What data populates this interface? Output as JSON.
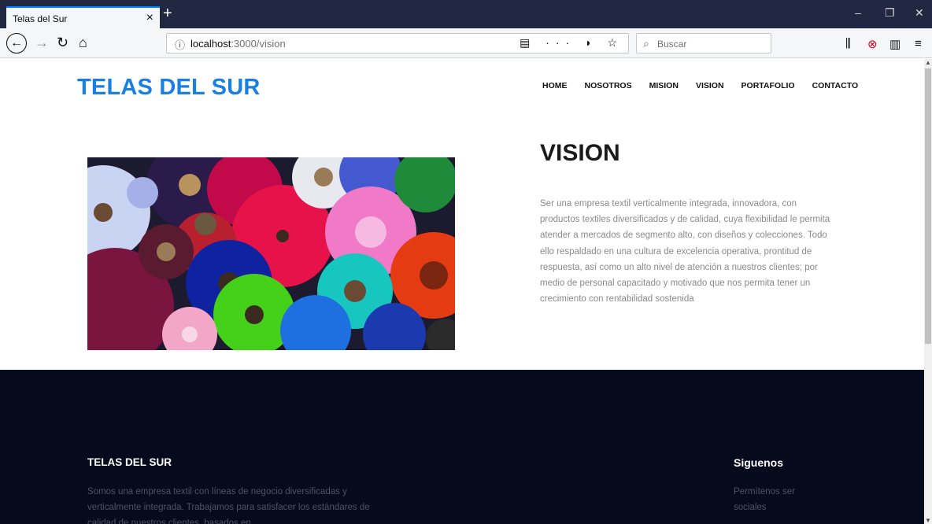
{
  "browser": {
    "tab_title": "Telas del Sur",
    "tab_close": "×",
    "new_tab": "+",
    "url_host": "localhost",
    "url_path": ":3000/vision",
    "search_placeholder": "Buscar",
    "minimize": "–",
    "restore": "❐",
    "close": "✕"
  },
  "site": {
    "logo": "TELAS DEL SUR",
    "menu": [
      "HOME",
      "NOSOTROS",
      "MISION",
      "VISION",
      "PORTAFOLIO",
      "CONTACTO"
    ]
  },
  "vision": {
    "title": "VISION",
    "text": "Ser una empresa textil verticalmente integrada, innovadora, con productos textiles diversificados y de calidad, cuya flexibilidad le permita atender a mercados de segmento alto, con diseños y colecciones. Todo ello respaldado en una cultura de excelencia operativa, prontitud de respuesta, así como un alto nivel de atención a nuestros clientes; por medio de personal capacitado y motivado que nos permita tener un crecimiento con rentabilidad sostenida"
  },
  "footer": {
    "brand": "TELAS DEL SUR",
    "about": "Somos una empresa textil con líneas de negocio diversificadas y verticalmente integrada. Trabajamos para satisfacer los estándares de calidad de nuestros clientes, basados en",
    "follow_title": "Siguenos",
    "follow_text": "Permítenos ser sociales"
  },
  "icons": [
    "back-icon",
    "forward-icon",
    "reload-icon",
    "home-icon",
    "info-icon",
    "reader-icon",
    "more-icon",
    "pocket-icon",
    "bookmark-star-icon",
    "search-icon",
    "library-icon",
    "blocked-icon",
    "sidebar-icon",
    "menu-icon"
  ]
}
